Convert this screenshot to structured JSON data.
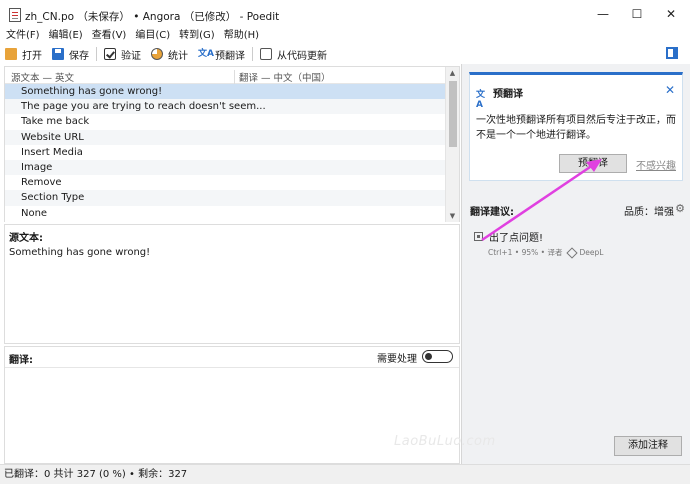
{
  "title": "zh_CN.po （未保存） • Angora （已修改） - Poedit",
  "window_controls": {
    "minimize": "—",
    "maximize": "☐",
    "close": "✕"
  },
  "menu": [
    "文件(F)",
    "编辑(E)",
    "查看(V)",
    "编目(C)",
    "转到(G)",
    "帮助(H)"
  ],
  "toolbar": {
    "open": "打开",
    "save": "保存",
    "validate": "验证",
    "stats": "统计",
    "pretranslate": "预翻译",
    "update": "从代码更新"
  },
  "list": {
    "col_source": "源文本 — 英文",
    "col_translation": "翻译 — 中文（中国）",
    "rows": [
      "Something has gone wrong!",
      "The page you are trying to reach doesn't seem...",
      "Take me back",
      "Website URL",
      "Insert Media",
      "Image",
      "Remove",
      "Section Type",
      "None"
    ],
    "selected_index": 0
  },
  "source_pane": {
    "header": "源文本:",
    "text": "Something has gone wrong!"
  },
  "translation_pane": {
    "header": "翻译:",
    "needs_work": "需要处理"
  },
  "sidebar": {
    "card": {
      "icon": "translate-icon",
      "title": "预翻译",
      "body": "一次性地预翻译所有项目然后专注于改正，而不是一个一个地进行翻译。",
      "button": "预翻译",
      "dismiss": "不感兴趣"
    },
    "suggestions_header": "翻译建议:",
    "quality": "品质：增强",
    "suggestion": {
      "text": "出了点问题!",
      "meta_prefix": "Ctrl+1 • 95% • 译者",
      "provider": "DeepL"
    },
    "add_note": "添加注释"
  },
  "watermark": "LaoBuLuo.com",
  "status": "已翻译：0 共计 327 (0 %) • 剩余：327",
  "colors": {
    "accent": "#2a6fc9",
    "selection": "#cde0f4",
    "arrow": "#e040e0"
  }
}
